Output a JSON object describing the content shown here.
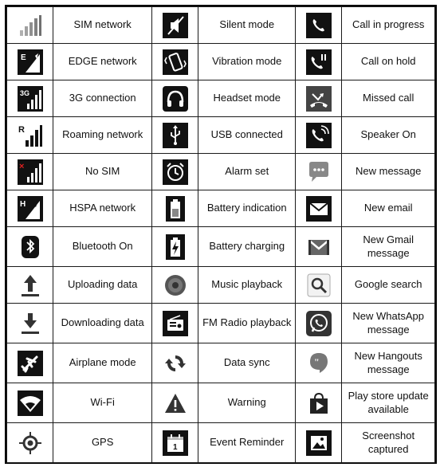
{
  "rows": [
    [
      {
        "icon": "signal-bars-icon",
        "label": "SIM network"
      },
      {
        "icon": "silent-mode-icon",
        "label": "Silent mode"
      },
      {
        "icon": "phone-icon",
        "label": "Call in progress"
      }
    ],
    [
      {
        "icon": "edge-signal-icon",
        "label": "EDGE network"
      },
      {
        "icon": "vibration-icon",
        "label": "Vibration mode"
      },
      {
        "icon": "call-hold-icon",
        "label": "Call on hold"
      }
    ],
    [
      {
        "icon": "3g-signal-icon",
        "label": "3G connection"
      },
      {
        "icon": "headset-icon",
        "label": "Headset mode"
      },
      {
        "icon": "missed-call-icon",
        "label": "Missed call"
      }
    ],
    [
      {
        "icon": "roaming-signal-icon",
        "label": "Roaming network"
      },
      {
        "icon": "usb-icon",
        "label": "USB connected"
      },
      {
        "icon": "speakerphone-icon",
        "label": "Speaker On"
      }
    ],
    [
      {
        "icon": "no-sim-icon",
        "label": "No SIM"
      },
      {
        "icon": "alarm-icon",
        "label": "Alarm set"
      },
      {
        "icon": "message-bubble-icon",
        "label": "New message"
      }
    ],
    [
      {
        "icon": "hspa-signal-icon",
        "label": "HSPA network"
      },
      {
        "icon": "battery-icon",
        "label": "Battery indication"
      },
      {
        "icon": "email-icon",
        "label": "New email"
      }
    ],
    [
      {
        "icon": "bluetooth-icon",
        "label": "Bluetooth On"
      },
      {
        "icon": "battery-charging-icon",
        "label": "Battery charging"
      },
      {
        "icon": "gmail-icon",
        "label": "New Gmail message"
      }
    ],
    [
      {
        "icon": "upload-icon",
        "label": "Uploading data"
      },
      {
        "icon": "music-disc-icon",
        "label": "Music playback"
      },
      {
        "icon": "search-icon",
        "label": "Google search"
      }
    ],
    [
      {
        "icon": "download-icon",
        "label": "Downloading data"
      },
      {
        "icon": "radio-icon",
        "label": "FM Radio playback"
      },
      {
        "icon": "whatsapp-icon",
        "label": "New WhatsApp message"
      }
    ],
    [
      {
        "icon": "airplane-icon",
        "label": "Airplane mode"
      },
      {
        "icon": "sync-icon",
        "label": "Data sync"
      },
      {
        "icon": "hangouts-icon",
        "label": "New Hangouts message"
      }
    ],
    [
      {
        "icon": "wifi-icon",
        "label": "Wi-Fi"
      },
      {
        "icon": "warning-icon",
        "label": "Warning"
      },
      {
        "icon": "play-store-icon",
        "label": "Play store update available"
      }
    ],
    [
      {
        "icon": "gps-icon",
        "label": "GPS"
      },
      {
        "icon": "calendar-icon",
        "label": "Event Reminder"
      },
      {
        "icon": "screenshot-icon",
        "label": "Screenshot captured"
      }
    ]
  ]
}
